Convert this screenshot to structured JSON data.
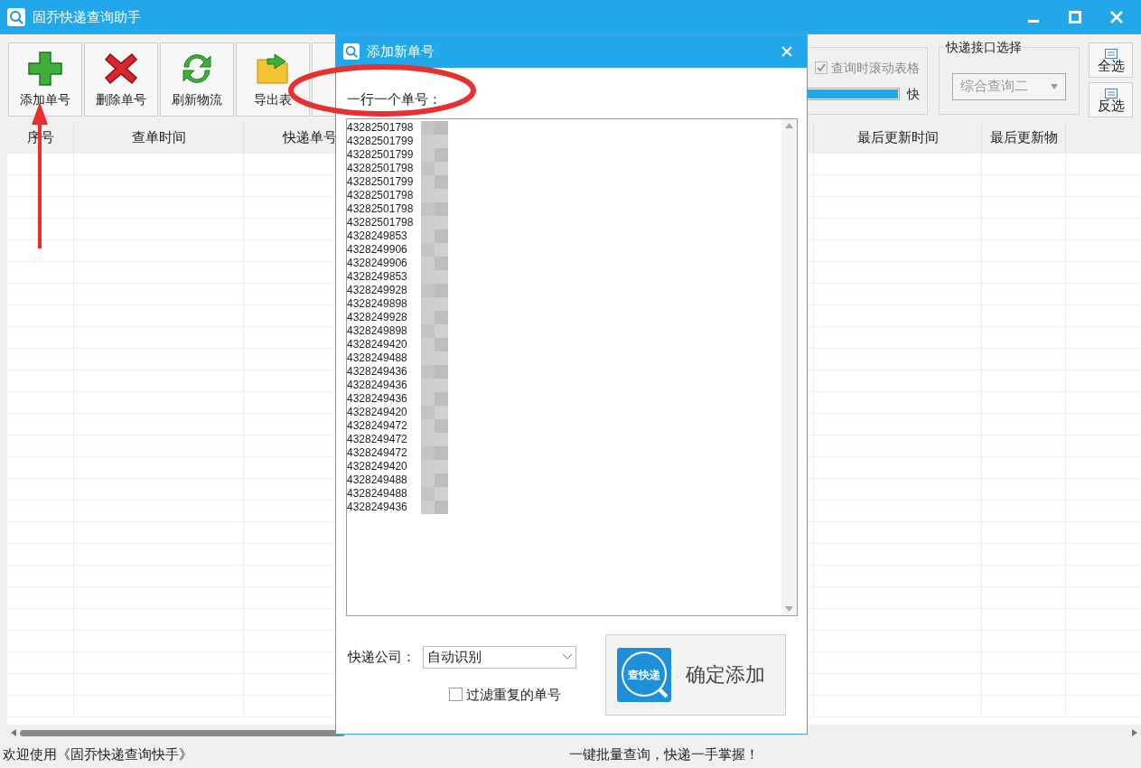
{
  "window": {
    "title": "固乔快递查询助手"
  },
  "toolbar": [
    {
      "kind": "add",
      "label": "添加单号"
    },
    {
      "kind": "delete",
      "label": "删除单号"
    },
    {
      "kind": "refresh",
      "label": "刷新物流"
    },
    {
      "kind": "export",
      "label": "导出表"
    }
  ],
  "scroll_option": {
    "label": "查询时滚动表格",
    "checked": true,
    "disabled": true
  },
  "speed": {
    "level": 1,
    "label": "快"
  },
  "api_group": {
    "title": "快递接口选择",
    "value": "综合查询二",
    "disabled": true
  },
  "select_buttons": [
    "全选",
    "反选"
  ],
  "table": {
    "columns": [
      "序号",
      "查单时间",
      "快递单号",
      "",
      "最后更新时间",
      "最后更新物"
    ]
  },
  "dialog": {
    "title": "添加新单号",
    "prompt": "一行一个单号：",
    "numbers": [
      "43282501798",
      "43282501799",
      "43282501799",
      "43282501798",
      "43282501799",
      "43282501798",
      "43282501798",
      "43282501798",
      "4328249853",
      "4328249906",
      "4328249906",
      "4328249853",
      "4328249928",
      "4328249898",
      "4328249928",
      "4328249898",
      "4328249420",
      "4328249488",
      "4328249436",
      "4328249436",
      "4328249436",
      "4328249420",
      "4328249472",
      "4328249472",
      "4328249472",
      "4328249420",
      "4328249488",
      "4328249488",
      "4328249436"
    ],
    "company_label": "快递公司：",
    "company_value": "自动识别",
    "filter": {
      "label": "过滤重复的单号",
      "checked": false
    },
    "confirm_icon_text": "查快递",
    "confirm": "确定添加"
  },
  "status_bar": [
    "欢迎使用《固乔快递查询快手》",
    "一键批量查询，快递一手掌握！"
  ]
}
